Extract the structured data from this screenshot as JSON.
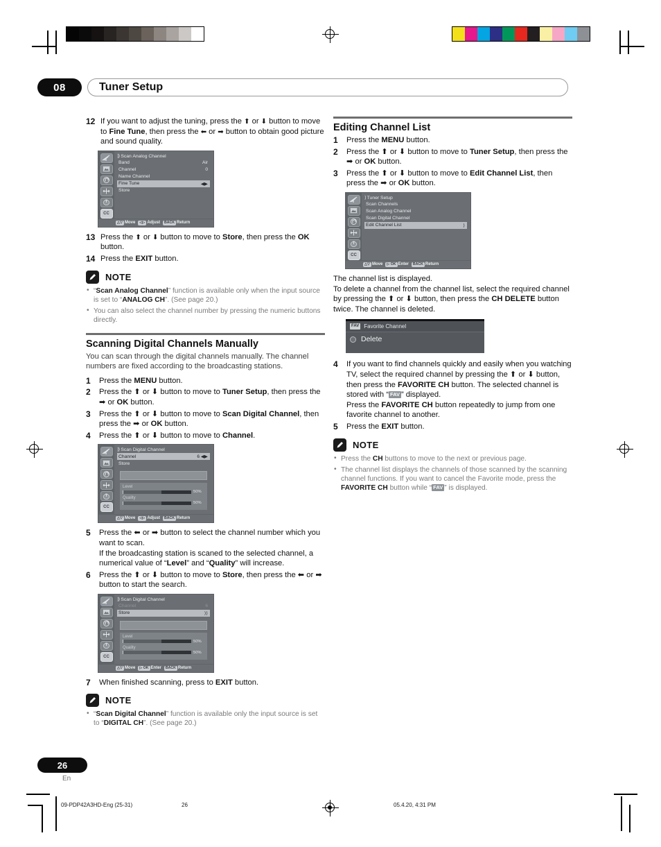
{
  "header": {
    "chapter_number": "08",
    "chapter_title": "Tuner Setup"
  },
  "page": {
    "number": "26",
    "language": "En"
  },
  "print_footer": {
    "file": "09-PDP42A3HD-Eng (25-31)",
    "page": "26",
    "date": "05.4.20, 4:31 PM"
  },
  "left_column": {
    "step12": {
      "num": "12",
      "text_1": "If you want to adjust the tuning, press the ",
      "arrow_up": "⬆",
      "or_1": " or ",
      "arrow_down": "⬇",
      "text_2": " button to move to ",
      "bold_1": "Fine Tune",
      "text_3": ", then press the ",
      "arrow_left": "⬅",
      "or_2": " or ",
      "arrow_right": "➡",
      "text_4": " button to obtain good picture and sound quality."
    },
    "osd_analog": {
      "title": "Scan Analog Channel",
      "rows": [
        {
          "label": "Band",
          "value": "Air",
          "highlight": false
        },
        {
          "label": "Channel",
          "value": "0",
          "highlight": false
        },
        {
          "label": "Name Channel",
          "value": "",
          "highlight": false
        },
        {
          "label": "Fine Tune",
          "value": "◀▶",
          "highlight": true
        },
        {
          "label": "Store",
          "value": "",
          "highlight": false
        }
      ],
      "footer": [
        {
          "key": "△▽",
          "label": "Move"
        },
        {
          "key": "◁▷",
          "label": "Adjust"
        },
        {
          "key": "BACK",
          "label": "Return"
        }
      ]
    },
    "step13": {
      "num": "13",
      "text_1": "Press the ",
      "text_2": " or ",
      "text_3": " button to move to ",
      "bold_1": "Store",
      "text_4": ", then press the ",
      "bold_2": "OK",
      "text_5": " button."
    },
    "step14": {
      "num": "14",
      "text_1": "Press the ",
      "bold_1": "EXIT",
      "text_2": " button."
    },
    "note1": {
      "word": "NOTE",
      "items": [
        {
          "p1": "“",
          "b1": "Scan Analog Channel",
          "p2": "” function is available only when the input source is set to “",
          "b2": "ANALOG CH",
          "p3": "”. (See page 20.)"
        },
        {
          "p1": "You can also select the channel number by pressing the numeric buttons directly.",
          "b1": "",
          "p2": "",
          "b2": "",
          "p3": ""
        }
      ]
    },
    "section_digital": {
      "title": "Scanning Digital Channels Manually",
      "intro": "You can scan through the digital channels manually. The channel numbers are fixed according to the broadcasting stations.",
      "steps": [
        {
          "num": "1",
          "t1": "Press the ",
          "b1": "MENU",
          "t2": " button.",
          "b2": "",
          "t3": ""
        },
        {
          "num": "2",
          "t1": "Press the ⬆ or ⬇ button to move to ",
          "b1": "Tuner Setup",
          "t2": ", then press the ➡ or ",
          "b2": "OK",
          "t3": " button."
        },
        {
          "num": "3",
          "t1": "Press the ⬆ or ⬇ button to move to ",
          "b1": "Scan Digital Channel",
          "t2": ", then press the ➡ or ",
          "b2": "OK",
          "t3": " button."
        },
        {
          "num": "4",
          "t1": "Press the ⬆ or ⬇ button to move to ",
          "b1": "Channel",
          "t2": ".",
          "b2": "",
          "t3": ""
        }
      ]
    },
    "osd_digital_1": {
      "title": "Scan Digital Channel",
      "rows": [
        {
          "label": "Channel",
          "value": "6 ◀▶",
          "highlight": true,
          "dim": false
        },
        {
          "label": "Store",
          "value": "",
          "highlight": false,
          "dim": false
        }
      ],
      "meters": [
        {
          "label": "Level",
          "pct": "50%",
          "fill": 56
        },
        {
          "label": "Quality",
          "pct": "50%",
          "fill": 56
        }
      ],
      "footer": [
        {
          "key": "△▽",
          "label": "Move"
        },
        {
          "key": "◁▷",
          "label": "Adjust"
        },
        {
          "key": "BACK",
          "label": "Return"
        }
      ]
    },
    "step5": {
      "num": "5",
      "line1": "Press the ⬅ or ➡ button to select the channel number which you want to scan.",
      "line2_a": "If the broadcasting station is scaned to the selected channel, a numerical value of “",
      "b1": "Level",
      "line2_b": "” and “",
      "b2": "Quality",
      "line2_c": "” will increase."
    },
    "step6": {
      "num": "6",
      "t1": "Press the ⬆ or ⬇ button to move to ",
      "b1": "Store",
      "t2": ", then press the ⬅ or ➡ button to start the search."
    },
    "osd_digital_2": {
      "title": "Scan Digital Channel",
      "rows": [
        {
          "label": "Channel",
          "value": "6",
          "highlight": false,
          "dim": true
        },
        {
          "label": "Store",
          "value": "⟩⟩",
          "highlight": true,
          "dim": false
        }
      ],
      "meters": [
        {
          "label": "Level",
          "pct": "50%",
          "fill": 56
        },
        {
          "label": "Quality",
          "pct": "50%",
          "fill": 56
        }
      ],
      "footer": [
        {
          "key": "△▽",
          "label": "Move"
        },
        {
          "key": "▷ OK",
          "label": "Enter"
        },
        {
          "key": "BACK",
          "label": "Return"
        }
      ]
    },
    "step7": {
      "num": "7",
      "t1": "When finished scanning, press to ",
      "b1": "EXIT",
      "t2": " button."
    },
    "note2": {
      "word": "NOTE",
      "items": [
        {
          "p1": "“",
          "b1": "Scan Digital Channel",
          "p2": "” function is available only the input source is set to “",
          "b2": "DIGITAL CH",
          "p3": "”. (See page 20.)"
        }
      ]
    }
  },
  "right_column": {
    "section_edit": {
      "title": "Editing Channel List",
      "steps": [
        {
          "num": "1",
          "t1": "Press the ",
          "b1": "MENU",
          "t2": " button.",
          "b2": "",
          "t3": ""
        },
        {
          "num": "2",
          "t1": "Press the ⬆ or ⬇ button to move to ",
          "b1": "Tuner Setup",
          "t2": ", then press the ➡ or ",
          "b2": "OK",
          "t3": " button."
        },
        {
          "num": "3",
          "t1": "Press the ⬆ or ⬇ button to move to ",
          "b1": "Edit Channel List",
          "t2": ", then press the ➡ or ",
          "b2": "OK",
          "t3": " button."
        }
      ]
    },
    "osd_tuner": {
      "title": "Tuner Setup",
      "rows": [
        {
          "label": "Scan Channels",
          "value": "",
          "highlight": false
        },
        {
          "label": "Scan Analog Channel",
          "value": "",
          "highlight": false
        },
        {
          "label": "Scan Digital Channel",
          "value": "",
          "highlight": false
        },
        {
          "label": "Edit Channel List",
          "value": "⟩",
          "highlight": true
        }
      ],
      "footer": [
        {
          "key": "△▽",
          "label": "Move"
        },
        {
          "key": "▷ OK",
          "label": "Enter"
        },
        {
          "key": "BACK",
          "label": "Return"
        }
      ]
    },
    "body_text": {
      "line1": "The channel list is displayed.",
      "line2_a": "To delete a channel from the channel list, select the required channel by pressing the ⬆ or ⬇ button, then press the ",
      "b1": "CH DELETE",
      "line2_b": " button twice. The channel is deleted."
    },
    "channel_box": {
      "fav_badge": "FAV",
      "head_label": "Favorite Channel",
      "item_label": "Delete"
    },
    "step4": {
      "num": "4",
      "t1": "If you want to find channels quickly and easily when you watching TV, select the required channel by pressing the ⬆ or ⬇ button, then press the ",
      "b1": "FAVORITE CH",
      "t2": " button. The selected channel is stored with “",
      "fav": "FAV",
      "t3": "” displayed.",
      "t4": "Press the ",
      "b2": "FAVORITE CH",
      "t5": " button repeatedly to jump from one favorite channel to another."
    },
    "step5": {
      "num": "5",
      "t1": "Press the ",
      "b1": "EXIT",
      "t2": " button."
    },
    "note": {
      "word": "NOTE",
      "items": [
        {
          "p1": "Press the ",
          "b1": "CH",
          "p2": " buttons to move to the next or previous page.",
          "b2": "",
          "p3": ""
        },
        {
          "p1": "The channel list displays the channels of those scanned by the scanning channel functions. If you want to cancel the Favorite mode, press the ",
          "b1": "FAVORITE CH",
          "p2": " button while “",
          "b2": "FAV",
          "p3": "” is displayed."
        }
      ]
    }
  },
  "color_bars": {
    "grayscale": [
      "#050505",
      "#0b0b0b",
      "#151211",
      "#282422",
      "#3b3631",
      "#4e4842",
      "#6a625b",
      "#8c8580",
      "#a9a4a0",
      "#cbc8c5",
      "#ffffff"
    ],
    "colors": [
      "#f3e01b",
      "#e6188c",
      "#03a5e2",
      "#2c2f85",
      "#00985a",
      "#e7281f",
      "#231f20",
      "#faf0a5",
      "#f6a7c5",
      "#6fccf3",
      "#8d9094"
    ]
  },
  "icons": {
    "rail": [
      "antenna-icon",
      "picture-icon",
      "audio-icon",
      "setup-icon",
      "globe-icon",
      "cc-icon"
    ],
    "note": "pencil-icon"
  }
}
